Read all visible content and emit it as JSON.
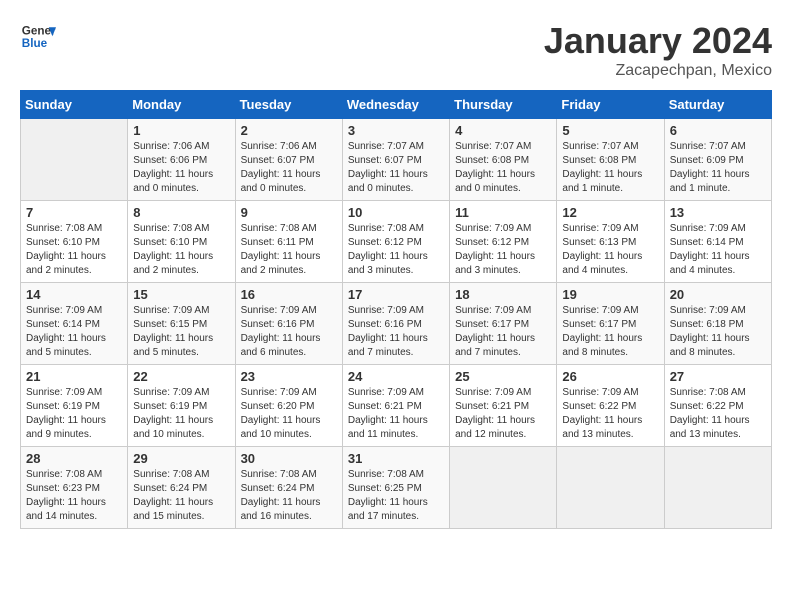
{
  "logo": {
    "line1": "General",
    "line2": "Blue"
  },
  "title": "January 2024",
  "subtitle": "Zacapechpan, Mexico",
  "days_header": [
    "Sunday",
    "Monday",
    "Tuesday",
    "Wednesday",
    "Thursday",
    "Friday",
    "Saturday"
  ],
  "weeks": [
    [
      {
        "num": "",
        "info": ""
      },
      {
        "num": "1",
        "info": "Sunrise: 7:06 AM\nSunset: 6:06 PM\nDaylight: 11 hours\nand 0 minutes."
      },
      {
        "num": "2",
        "info": "Sunrise: 7:06 AM\nSunset: 6:07 PM\nDaylight: 11 hours\nand 0 minutes."
      },
      {
        "num": "3",
        "info": "Sunrise: 7:07 AM\nSunset: 6:07 PM\nDaylight: 11 hours\nand 0 minutes."
      },
      {
        "num": "4",
        "info": "Sunrise: 7:07 AM\nSunset: 6:08 PM\nDaylight: 11 hours\nand 0 minutes."
      },
      {
        "num": "5",
        "info": "Sunrise: 7:07 AM\nSunset: 6:08 PM\nDaylight: 11 hours\nand 1 minute."
      },
      {
        "num": "6",
        "info": "Sunrise: 7:07 AM\nSunset: 6:09 PM\nDaylight: 11 hours\nand 1 minute."
      }
    ],
    [
      {
        "num": "7",
        "info": "Sunrise: 7:08 AM\nSunset: 6:10 PM\nDaylight: 11 hours\nand 2 minutes."
      },
      {
        "num": "8",
        "info": "Sunrise: 7:08 AM\nSunset: 6:10 PM\nDaylight: 11 hours\nand 2 minutes."
      },
      {
        "num": "9",
        "info": "Sunrise: 7:08 AM\nSunset: 6:11 PM\nDaylight: 11 hours\nand 2 minutes."
      },
      {
        "num": "10",
        "info": "Sunrise: 7:08 AM\nSunset: 6:12 PM\nDaylight: 11 hours\nand 3 minutes."
      },
      {
        "num": "11",
        "info": "Sunrise: 7:09 AM\nSunset: 6:12 PM\nDaylight: 11 hours\nand 3 minutes."
      },
      {
        "num": "12",
        "info": "Sunrise: 7:09 AM\nSunset: 6:13 PM\nDaylight: 11 hours\nand 4 minutes."
      },
      {
        "num": "13",
        "info": "Sunrise: 7:09 AM\nSunset: 6:14 PM\nDaylight: 11 hours\nand 4 minutes."
      }
    ],
    [
      {
        "num": "14",
        "info": "Sunrise: 7:09 AM\nSunset: 6:14 PM\nDaylight: 11 hours\nand 5 minutes."
      },
      {
        "num": "15",
        "info": "Sunrise: 7:09 AM\nSunset: 6:15 PM\nDaylight: 11 hours\nand 5 minutes."
      },
      {
        "num": "16",
        "info": "Sunrise: 7:09 AM\nSunset: 6:16 PM\nDaylight: 11 hours\nand 6 minutes."
      },
      {
        "num": "17",
        "info": "Sunrise: 7:09 AM\nSunset: 6:16 PM\nDaylight: 11 hours\nand 7 minutes."
      },
      {
        "num": "18",
        "info": "Sunrise: 7:09 AM\nSunset: 6:17 PM\nDaylight: 11 hours\nand 7 minutes."
      },
      {
        "num": "19",
        "info": "Sunrise: 7:09 AM\nSunset: 6:17 PM\nDaylight: 11 hours\nand 8 minutes."
      },
      {
        "num": "20",
        "info": "Sunrise: 7:09 AM\nSunset: 6:18 PM\nDaylight: 11 hours\nand 8 minutes."
      }
    ],
    [
      {
        "num": "21",
        "info": "Sunrise: 7:09 AM\nSunset: 6:19 PM\nDaylight: 11 hours\nand 9 minutes."
      },
      {
        "num": "22",
        "info": "Sunrise: 7:09 AM\nSunset: 6:19 PM\nDaylight: 11 hours\nand 10 minutes."
      },
      {
        "num": "23",
        "info": "Sunrise: 7:09 AM\nSunset: 6:20 PM\nDaylight: 11 hours\nand 10 minutes."
      },
      {
        "num": "24",
        "info": "Sunrise: 7:09 AM\nSunset: 6:21 PM\nDaylight: 11 hours\nand 11 minutes."
      },
      {
        "num": "25",
        "info": "Sunrise: 7:09 AM\nSunset: 6:21 PM\nDaylight: 11 hours\nand 12 minutes."
      },
      {
        "num": "26",
        "info": "Sunrise: 7:09 AM\nSunset: 6:22 PM\nDaylight: 11 hours\nand 13 minutes."
      },
      {
        "num": "27",
        "info": "Sunrise: 7:08 AM\nSunset: 6:22 PM\nDaylight: 11 hours\nand 13 minutes."
      }
    ],
    [
      {
        "num": "28",
        "info": "Sunrise: 7:08 AM\nSunset: 6:23 PM\nDaylight: 11 hours\nand 14 minutes."
      },
      {
        "num": "29",
        "info": "Sunrise: 7:08 AM\nSunset: 6:24 PM\nDaylight: 11 hours\nand 15 minutes."
      },
      {
        "num": "30",
        "info": "Sunrise: 7:08 AM\nSunset: 6:24 PM\nDaylight: 11 hours\nand 16 minutes."
      },
      {
        "num": "31",
        "info": "Sunrise: 7:08 AM\nSunset: 6:25 PM\nDaylight: 11 hours\nand 17 minutes."
      },
      {
        "num": "",
        "info": ""
      },
      {
        "num": "",
        "info": ""
      },
      {
        "num": "",
        "info": ""
      }
    ]
  ]
}
